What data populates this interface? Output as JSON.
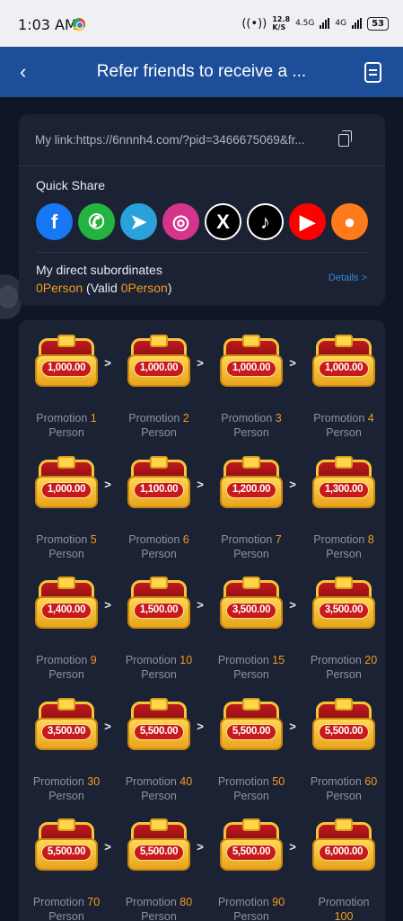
{
  "status_bar": {
    "time": "1:03 AM",
    "speed_value": "12.8",
    "speed_unit": "K/S",
    "net1": "4.5G",
    "net2": "4G",
    "battery": "53"
  },
  "header": {
    "title": "Refer friends to receive a ...",
    "back_icon": "back-arrow-icon",
    "doc_icon": "document-icon"
  },
  "link": {
    "text": "My link:https://6nnnh4.com/?pid=3466675069&fr..."
  },
  "quick_share": {
    "label": "Quick Share",
    "icons": [
      {
        "name": "facebook-icon",
        "glyph": "f",
        "color": "#1877f2"
      },
      {
        "name": "whatsapp-icon",
        "glyph": "✆",
        "color": "#25b33f"
      },
      {
        "name": "telegram-icon",
        "glyph": "➤",
        "color": "#2aa1da"
      },
      {
        "name": "instagram-icon",
        "glyph": "◎",
        "color": "#d6348a"
      },
      {
        "name": "x-icon",
        "glyph": "X",
        "color": "#000000"
      },
      {
        "name": "tiktok-icon",
        "glyph": "♪",
        "color": "#000000"
      },
      {
        "name": "youtube-icon",
        "glyph": "▶",
        "color": "#ff0000"
      },
      {
        "name": "kwai-icon",
        "glyph": "●",
        "color": "#ff7a1a"
      }
    ]
  },
  "subordinates": {
    "label": "My direct subordinates",
    "count": "0Person",
    "valid_prefix": " (Valid ",
    "valid_count": "0Person",
    "valid_suffix": ")",
    "details": "Details >"
  },
  "rewards": [
    [
      {
        "amount": "1,000.00",
        "prefix": "Promotion ",
        "n": "1"
      },
      {
        "amount": "1,000.00",
        "prefix": "Promotion ",
        "n": "2"
      },
      {
        "amount": "1,000.00",
        "prefix": "Promotion ",
        "n": "3"
      },
      {
        "amount": "1,000.00",
        "prefix": "Promotion ",
        "n": "4"
      }
    ],
    [
      {
        "amount": "1,000.00",
        "prefix": "Promotion ",
        "n": "5"
      },
      {
        "amount": "1,100.00",
        "prefix": "Promotion ",
        "n": "6"
      },
      {
        "amount": "1,200.00",
        "prefix": "Promotion ",
        "n": "7"
      },
      {
        "amount": "1,300.00",
        "prefix": "Promotion ",
        "n": "8"
      }
    ],
    [
      {
        "amount": "1,400.00",
        "prefix": "Promotion ",
        "n": "9"
      },
      {
        "amount": "1,500.00",
        "prefix": "Promotion ",
        "n": "10"
      },
      {
        "amount": "3,500.00",
        "prefix": "Promotion ",
        "n": "15"
      },
      {
        "amount": "3,500.00",
        "prefix": "Promotion ",
        "n": "20"
      }
    ],
    [
      {
        "amount": "3,500.00",
        "prefix": "Promotion ",
        "n": "30"
      },
      {
        "amount": "5,500.00",
        "prefix": "Promotion ",
        "n": "40"
      },
      {
        "amount": "5,500.00",
        "prefix": "Promotion ",
        "n": "50"
      },
      {
        "amount": "5,500.00",
        "prefix": "Promotion ",
        "n": "60"
      }
    ],
    [
      {
        "amount": "5,500.00",
        "prefix": "Promotion ",
        "n": "70"
      },
      {
        "amount": "5,500.00",
        "prefix": "Promotion ",
        "n": "80"
      },
      {
        "amount": "5,500.00",
        "prefix": "Promotion ",
        "n": "90"
      },
      {
        "amount": "6,000.00",
        "prefix": "Promotion\n",
        "n": "100"
      }
    ]
  ],
  "person_label": "Person",
  "arrow": ">"
}
